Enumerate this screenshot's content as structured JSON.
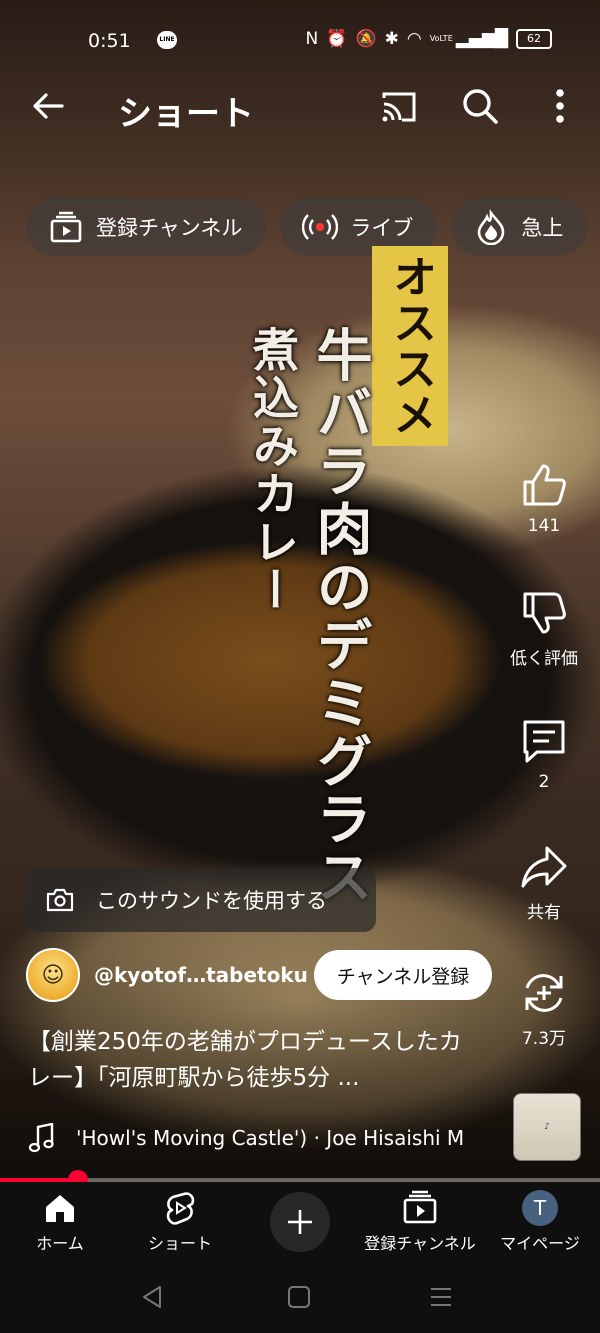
{
  "status_bar": {
    "time": "0:51",
    "battery": "62",
    "network": "VoLTE"
  },
  "header": {
    "title": "ショート"
  },
  "chips": [
    {
      "label": "登録チャンネル",
      "icon": "subscriptions-icon"
    },
    {
      "label": "ライブ",
      "icon": "live-icon"
    },
    {
      "label": "急上",
      "icon": "trending-icon"
    }
  ],
  "video_overlay": {
    "line1": "オススメ",
    "line2": "牛バラ肉のデミグラス",
    "line3": "煮込みカレー"
  },
  "actions": {
    "like_count": "141",
    "dislike_label": "低く評価",
    "comment_count": "2",
    "share_label": "共有",
    "remix_count": "7.3万"
  },
  "sound_button": {
    "label": "このサウンドを使用する"
  },
  "channel": {
    "handle": "@kyotof…tabetoku",
    "subscribe_label": "チャンネル登録"
  },
  "description": {
    "text": "【創業250年の老舗がプロデュースしたカレー】「河原町駅から徒歩5分 ..."
  },
  "music": {
    "track": "'Howl's Moving Castle') · Joe Hisaishi   M"
  },
  "progress": {
    "fraction": 0.13
  },
  "bottom_nav": {
    "home": "ホーム",
    "shorts": "ショート",
    "subscriptions": "登録チャンネル",
    "my_page": "マイページ",
    "avatar_letter": "T"
  },
  "colors": {
    "accent": "#ff0033",
    "nav_bg": "#0f0f0f",
    "avatar_bg": "#47617f",
    "highlight": "#e5c545"
  }
}
